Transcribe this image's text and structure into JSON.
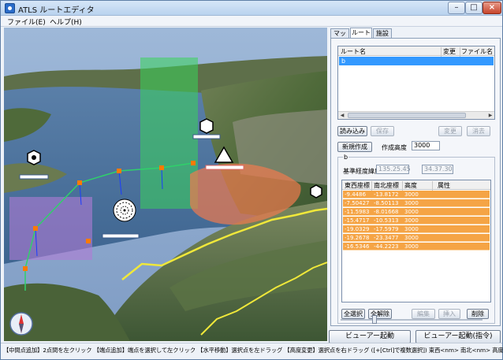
{
  "window": {
    "title": "ATLS ルートエディタ"
  },
  "menu": {
    "file": "ファイル(E)",
    "help": "ヘルプ(H)"
  },
  "tabs": {
    "map": "マップ",
    "route": "ルート",
    "facility": "施設"
  },
  "route_list": {
    "col_name": "ルート名",
    "col_changed": "変更",
    "col_filename": "ファイル名",
    "rows": [
      {
        "name": "b",
        "changed": "",
        "filename": ""
      }
    ]
  },
  "buttons": {
    "load": "読み込み",
    "save": "保存",
    "change": "変更",
    "erase": "消去",
    "new": "新規作成",
    "select_all": "全選択",
    "clear_all": "全解除",
    "edit": "編集",
    "insert": "挿入",
    "delete": "削除",
    "viewer": "ビューアー起動",
    "viewer_cmd": "ビューアー起動(指令)"
  },
  "create_altitude": {
    "label": "作成高度",
    "value": "3000"
  },
  "route_group": {
    "title": "b",
    "base_label": "基準経度緯度",
    "base_lon": "135.25.45",
    "base_lat": "34.37.30"
  },
  "points": {
    "col_east": "東西座標",
    "col_north": "南北座標",
    "col_alt": "高度",
    "col_attr": "属性",
    "rows": [
      {
        "east": "-9.4486",
        "north": "-13.8172",
        "alt": "3000"
      },
      {
        "east": "-7.50427",
        "north": "-8.50113",
        "alt": "3000"
      },
      {
        "east": "-11.5983",
        "north": "-8.01668",
        "alt": "3000"
      },
      {
        "east": "-15.4717",
        "north": "-10.5313",
        "alt": "3000"
      },
      {
        "east": "-19.0329",
        "north": "-17.5979",
        "alt": "3000"
      },
      {
        "east": "-19.2678",
        "north": "-23.3477",
        "alt": "3000"
      },
      {
        "east": "-16.5346",
        "north": "-44.2223",
        "alt": "3000"
      }
    ]
  },
  "status": "【中間点追加】2点間を左クリック 【端点追加】端点を選択して左クリック 【水平移動】選択点を左ドラッグ 【高度変更】選択点を右ドラッグ ([+[Ctrl]で複数選択]) 東西<nm> 南北<nm> 高度<ft>",
  "colors": {
    "selection": "#3399ff",
    "point_row": "#f5a445",
    "route_line": "#2fd16a"
  },
  "icons": [
    "app-icon",
    "compass-icon",
    "radar-station-icon",
    "triangle-marker-icon",
    "target-icon"
  ]
}
